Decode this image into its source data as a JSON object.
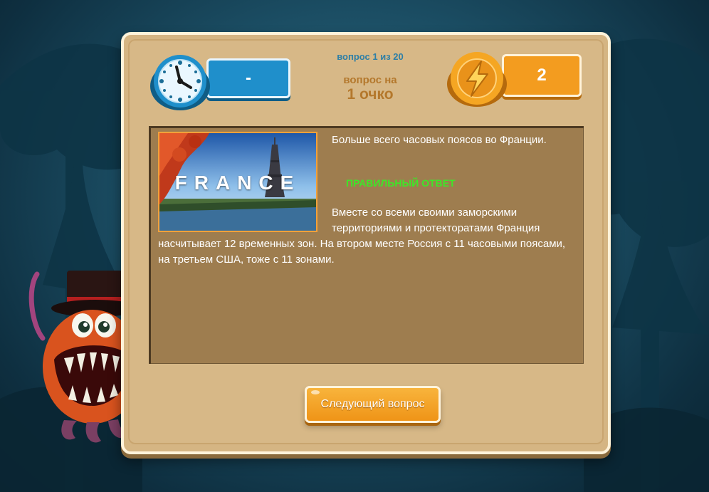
{
  "header": {
    "timer_value": "-",
    "question_counter": "вопрос 1 из 20",
    "worth_line1": "вопрос на",
    "worth_line2": "1 очко",
    "score_value": "2"
  },
  "question": {
    "image_caption": "FRANCE",
    "text": "Больше всего часовых поясов во Франции.",
    "verdict": "ПРАВИЛЬНЫЙ ОТВЕТ",
    "explanation": "Вместе со всеми своими заморскими территориями и протекторатами Франция насчитывает 12 временных зон. На втором месте Россия с 11 часовыми поясами, на третьем США, тоже с 11 зонами."
  },
  "actions": {
    "next_label": "Следующий вопрос"
  },
  "colors": {
    "panel": "#d5b583",
    "content": "#9e7d4f",
    "timer_blue": "#1f8fcb",
    "score_orange": "#f39c1f",
    "verdict_green": "#3ee628",
    "counter_blue": "#2e7fa6",
    "worth_brown": "#b4782c"
  },
  "icons": {
    "timer": "clock-icon",
    "score": "lightning-coin-icon"
  }
}
